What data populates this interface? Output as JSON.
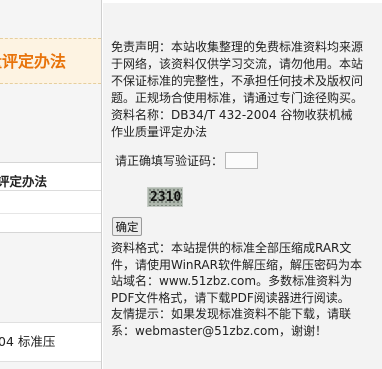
{
  "left": {
    "title": "量评定办法",
    "panel_heading": "评定办法",
    "bottom_text": "04 标准压"
  },
  "disclaimer_lines": [
    "免责声明：本站收集整理的免费标准资料均来源",
    "于网络，该资料仅供学习交流，请勿他用。本站",
    "不保证标准的完整性，不承担任何技术及版权问",
    "题。正规场合使用标准，请通过专门途径购买。",
    "资料名称：DB34/T 432-2004 谷物收获机械",
    "作业质量评定办法"
  ],
  "captcha": {
    "label": "请正确填写验证码：",
    "input_value": "",
    "code": "2310",
    "submit_label": "确定"
  },
  "info_lines": [
    "资料格式：本站提供的标准全部压缩成RAR文",
    "件，请使用WinRAR软件解压缩，解压密码为本",
    "站域名：www.51zbz.com。多数标准资料为",
    "PDF文件格式，请下载PDF阅读器进行阅读。",
    "友情提示：如果发现标准资料不能下载，请联",
    "系：webmaster@51zbz.com，谢谢！"
  ]
}
